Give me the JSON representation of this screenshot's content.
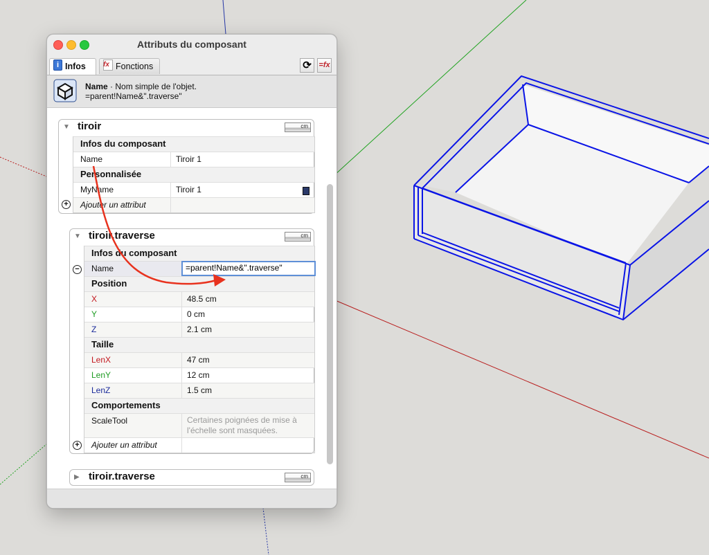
{
  "window": {
    "title": "Attributs du composant"
  },
  "tabs": [
    {
      "label": "Infos",
      "icon": "info-icon",
      "active": true
    },
    {
      "label": "Fonctions",
      "icon": "function-icon",
      "active": false
    }
  ],
  "toolbar": {
    "refresh_icon": "refresh-icon",
    "formula_icon": "formula-icon"
  },
  "header": {
    "name_label": "Name",
    "description": " · Nom simple de l'objet.",
    "formula": "=parent!Name&\".traverse\""
  },
  "components": [
    {
      "title": "tiroir",
      "expanded": true,
      "unit": "cm",
      "sections": [
        {
          "heading": "Infos du composant",
          "rows": [
            {
              "key": "Name",
              "value": "Tiroir 1"
            }
          ]
        },
        {
          "heading": "Personnalisée",
          "rows": [
            {
              "key": "MyName",
              "value": "Tiroir 1"
            }
          ]
        }
      ],
      "add_attribute": "Ajouter un attribut"
    },
    {
      "title": "tiroir.traverse",
      "expanded": true,
      "unit": "cm",
      "sections": [
        {
          "heading": "Infos du composant",
          "rows": [
            {
              "key": "Name",
              "value": "=parent!Name&\".traverse\""
            }
          ]
        },
        {
          "heading": "Position",
          "rows": [
            {
              "key": "X",
              "value": "48.5 cm"
            },
            {
              "key": "Y",
              "value": "0 cm"
            },
            {
              "key": "Z",
              "value": "2.1 cm"
            }
          ]
        },
        {
          "heading": "Taille",
          "rows": [
            {
              "key": "LenX",
              "value": "47 cm"
            },
            {
              "key": "LenY",
              "value": "12 cm"
            },
            {
              "key": "LenZ",
              "value": "1.5 cm"
            }
          ]
        },
        {
          "heading": "Comportements",
          "rows": [
            {
              "key": "ScaleTool",
              "value": "Certaines poignées de mise à",
              "value_line2": "l'échelle sont masquées."
            }
          ]
        }
      ],
      "add_attribute": "Ajouter un attribut"
    },
    {
      "title": "tiroir.traverse",
      "expanded": false,
      "unit": "cm"
    }
  ],
  "colors": {
    "axis_x": "#c2161d",
    "axis_y": "#1d9b22",
    "axis_z": "#1a2a9a",
    "selection": "#0a14e6",
    "annotation_arrow": "#e8321e"
  }
}
